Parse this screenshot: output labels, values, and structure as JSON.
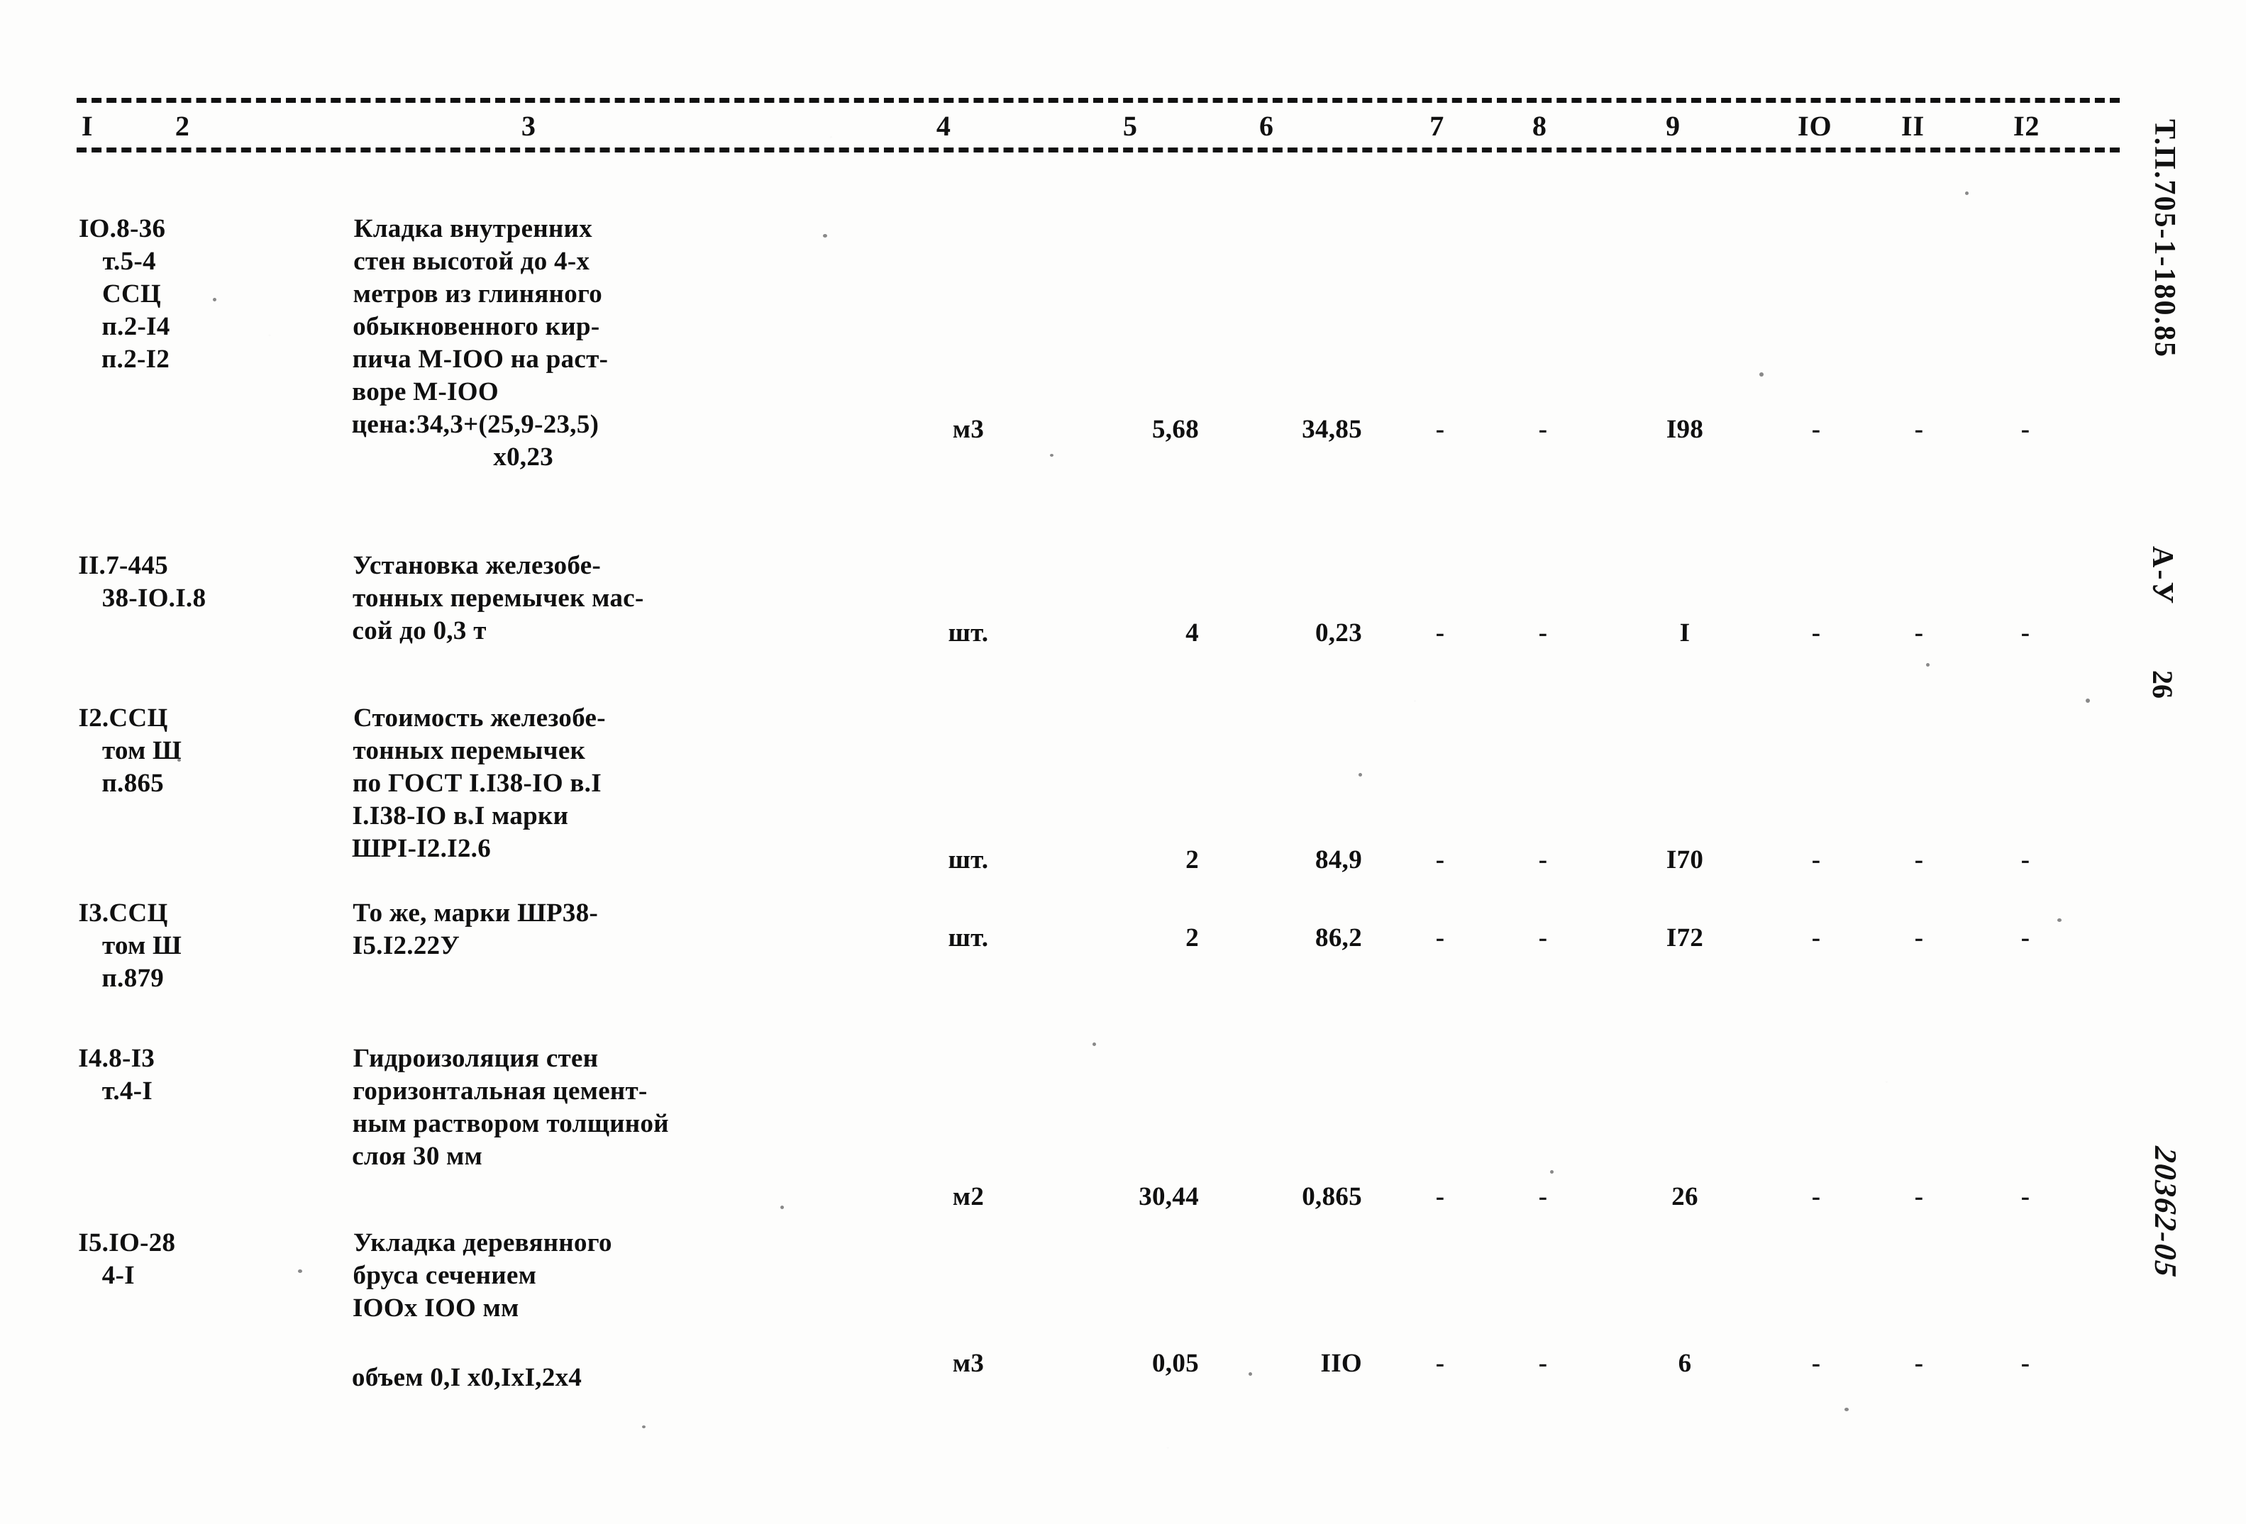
{
  "document": {
    "code": "Т.П.705-1-180.85",
    "series": "А-У",
    "sheet": "26",
    "archive_number": "20362-05"
  },
  "table": {
    "column_headers": [
      "I",
      "2",
      "3",
      "4",
      "5",
      "6",
      "7",
      "8",
      "9",
      "IO",
      "II",
      "I2"
    ],
    "dash": "-",
    "rows": [
      {
        "code_main": "IO.8-36",
        "code_sub": [
          "т.5-4",
          "ССЦ",
          "п.2-I4",
          "п.2-I2"
        ],
        "description": [
          "Кладка внутренних",
          "стен высотой до 4-х",
          "метров из глиняного",
          "обыкновенного кир-",
          "пича М-IОО на раст-",
          "воре М-IОО"
        ],
        "description_extra": [
          "цена:34,3+(25,9-23,5)"
        ],
        "description_extra_indent": [
          "х0,23"
        ],
        "unit": "м3",
        "qty": "5,68",
        "price": "34,85",
        "c7": "-",
        "c8": "-",
        "total": "I98",
        "c10": "-",
        "c11": "-",
        "c12": "-"
      },
      {
        "code_main": "II.7-445",
        "code_sub": [
          "38-IO.I.8"
        ],
        "description": [
          "Установка железобе-",
          "тонных перемычек мас-",
          "сой до 0,3 т"
        ],
        "description_extra": [],
        "description_extra_indent": [],
        "unit": "шт.",
        "qty": "4",
        "price": "0,23",
        "c7": "-",
        "c8": "-",
        "total": "I",
        "c10": "-",
        "c11": "-",
        "c12": "-"
      },
      {
        "code_main": "I2.ССЦ",
        "code_sub": [
          "том Ш",
          "п.865"
        ],
        "description": [
          "Стоимость железобе-",
          "тонных перемычек",
          "по ГОСТ I.I38-IO в.I",
          "I.I38-IO в.I марки",
          "ШРI-I2.I2.6"
        ],
        "description_extra": [],
        "description_extra_indent": [],
        "unit": "шт.",
        "qty": "2",
        "price": "84,9",
        "c7": "-",
        "c8": "-",
        "total": "I70",
        "c10": "-",
        "c11": "-",
        "c12": "-"
      },
      {
        "code_main": "I3.ССЦ",
        "code_sub": [
          "том Ш",
          "п.879"
        ],
        "description": [
          "То же, марки ШР38-",
          "I5.I2.22У"
        ],
        "description_extra": [],
        "description_extra_indent": [],
        "unit": "шт.",
        "qty": "2",
        "price": "86,2",
        "c7": "-",
        "c8": "-",
        "total": "I72",
        "c10": "-",
        "c11": "-",
        "c12": "-"
      },
      {
        "code_main": "I4.8-I3",
        "code_sub": [
          "т.4-I"
        ],
        "description": [
          "Гидроизоляция стен",
          "горизонтальная цемент-",
          "ным раствором толщиной",
          "слоя 30 мм"
        ],
        "description_extra": [],
        "description_extra_indent": [],
        "unit": "м2",
        "qty": "30,44",
        "price": "0,865",
        "c7": "-",
        "c8": "-",
        "total": "26",
        "c10": "-",
        "c11": "-",
        "c12": "-"
      },
      {
        "code_main": "I5.IO-28",
        "code_sub": [
          "4-I"
        ],
        "description": [
          "Укладка деревянного",
          "бруса сечением",
          "IOOx IOO мм"
        ],
        "description_extra": [
          "объем 0,I х0,IхI,2х4"
        ],
        "description_extra_indent": [],
        "unit": "м3",
        "qty": "0,05",
        "price": "IIO",
        "c7": "-",
        "c8": "-",
        "total": "6",
        "c10": "-",
        "c11": "-",
        "c12": "-"
      }
    ]
  }
}
